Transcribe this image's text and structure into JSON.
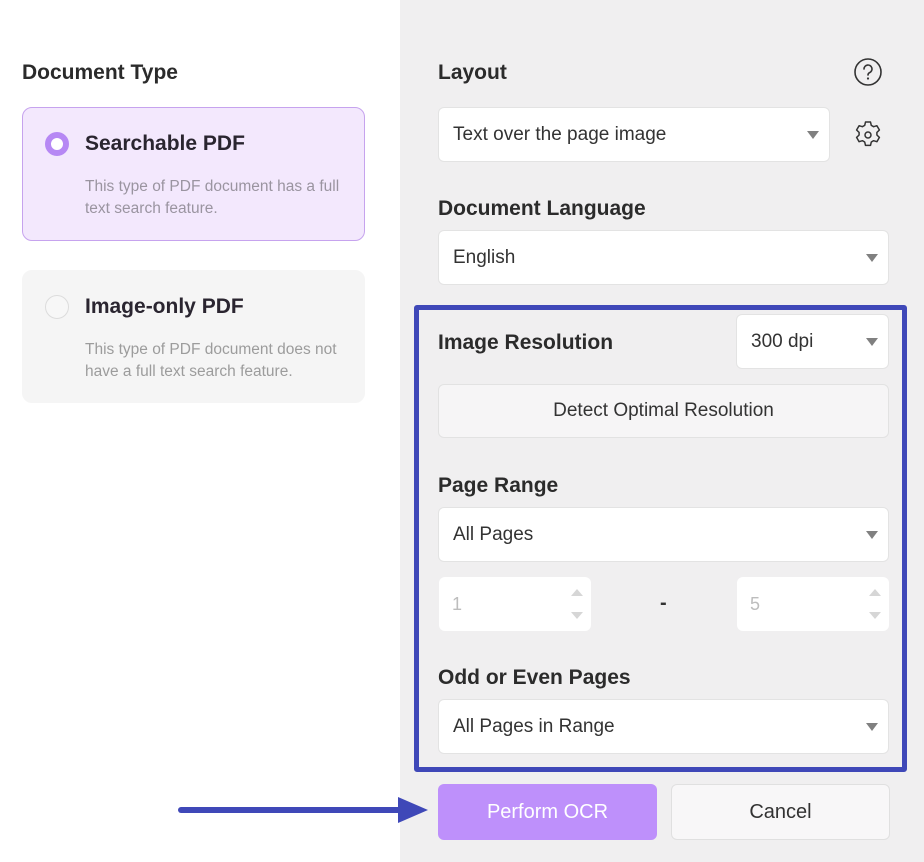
{
  "document_type": {
    "title": "Document Type",
    "options": [
      {
        "label": "Searchable PDF",
        "description": "This type of PDF document has a full text search feature.",
        "selected": true
      },
      {
        "label": "Image-only PDF",
        "description": "This type of PDF document does not have a full text search feature.",
        "selected": false
      }
    ]
  },
  "layout": {
    "title": "Layout",
    "value": "Text over the page image",
    "help_icon": "question-circle-icon",
    "settings_icon": "gear-icon"
  },
  "document_language": {
    "title": "Document Language",
    "value": "English"
  },
  "image_resolution": {
    "title": "Image Resolution",
    "value": "300 dpi",
    "detect_button": "Detect Optimal Resolution"
  },
  "page_range": {
    "title": "Page Range",
    "value": "All Pages",
    "from": "1",
    "separator": "-",
    "to": "5"
  },
  "odd_even": {
    "title": "Odd or Even Pages",
    "value": "All Pages in Range"
  },
  "actions": {
    "perform_ocr": "Perform OCR",
    "cancel": "Cancel"
  },
  "colors": {
    "accent": "#be90fb",
    "radio_selected": "#b688f4",
    "highlight_annotation": "#3f48b8"
  }
}
